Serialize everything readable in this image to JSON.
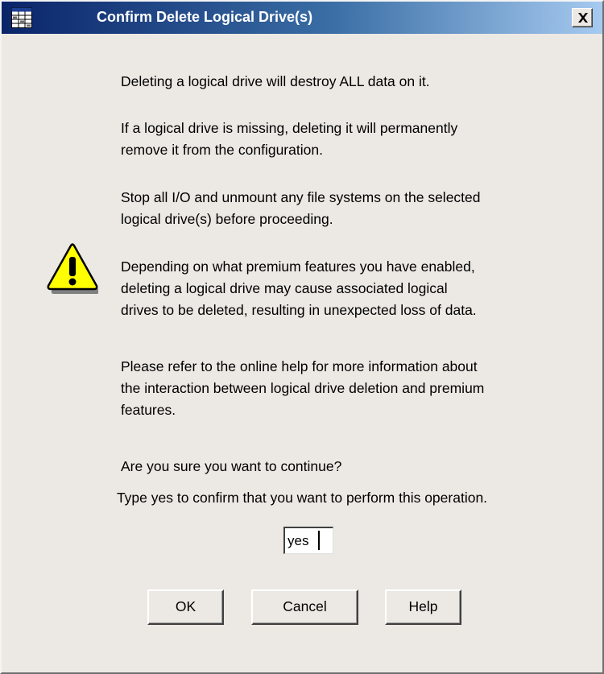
{
  "window": {
    "title": "Confirm Delete Logical Drive(s)",
    "app_icon": "grid-app-icon",
    "close_icon": "close-icon",
    "close_label": "×"
  },
  "warning_icon": "warning-exclamation-icon",
  "message": {
    "paragraphs": [
      [
        "Deleting a logical drive will destroy ALL data on it."
      ],
      [
        "If a logical drive is missing, deleting it will permanently",
        "remove it from the configuration."
      ],
      [
        "Stop all I/O and unmount any file systems on the selected",
        "logical drive(s) before proceeding."
      ],
      [
        "Depending on what premium features you have enabled,",
        "deleting a logical drive may cause associated logical",
        "drives to be deleted, resulting in unexpected loss of data."
      ],
      [
        "Please refer to the online help for more information about",
        "the interaction between logical drive deletion and premium",
        "features."
      ],
      [
        "Are you sure you want to continue?"
      ]
    ]
  },
  "confirm": {
    "prompt": "Type yes to confirm that you want to perform this operation.",
    "value": "yes"
  },
  "buttons": {
    "ok": "OK",
    "cancel": "Cancel",
    "help": "Help"
  },
  "colors": {
    "titlebar_start": "#0a246a",
    "titlebar_end": "#a6caf0",
    "dialog_bg": "#ece9e4",
    "warning_fill": "#ffff00"
  }
}
